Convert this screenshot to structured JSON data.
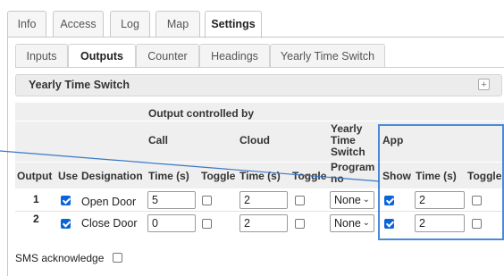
{
  "top_tabs": [
    {
      "label": "Info",
      "active": false
    },
    {
      "label": "Access",
      "active": false
    },
    {
      "label": "Log",
      "active": false
    },
    {
      "label": "Map",
      "active": false
    },
    {
      "label": "Settings",
      "active": true
    }
  ],
  "sub_tabs": [
    {
      "label": "Inputs",
      "active": false
    },
    {
      "label": "Outputs",
      "active": true
    },
    {
      "label": "Counter",
      "active": false
    },
    {
      "label": "Headings",
      "active": false
    },
    {
      "label": "Yearly Time Switch",
      "active": false
    }
  ],
  "section": {
    "title": "Yearly Time Switch",
    "expand_icon": "plus-icon"
  },
  "table": {
    "group_header": "Output controlled by",
    "call": "Call",
    "cloud": "Cloud",
    "yearly": "Yearly Time Switch",
    "app": "App",
    "columns": {
      "output": "Output",
      "use": "Use",
      "designation": "Designation",
      "call_time": "Time (s)",
      "call_toggle": "Toggle",
      "cloud_time": "Time (s)",
      "cloud_toggle": "Toggle",
      "program": "Program no",
      "app_show": "Show",
      "app_time": "Time (s)",
      "app_toggle": "Toggle"
    },
    "rows": [
      {
        "output": "1",
        "use": true,
        "designation": "Open Door",
        "call_time": "5",
        "call_toggle": false,
        "cloud_time": "2",
        "cloud_toggle": false,
        "program": "None",
        "app_show": true,
        "app_time": "2",
        "app_toggle": false
      },
      {
        "output": "2",
        "use": true,
        "designation": "Close Door",
        "call_time": "0",
        "call_toggle": false,
        "cloud_time": "2",
        "cloud_toggle": false,
        "program": "None",
        "app_show": true,
        "app_time": "2",
        "app_toggle": false
      }
    ]
  },
  "sms": {
    "label": "SMS acknowledge",
    "checked": false
  },
  "colors": {
    "accent": "#4a8ad8",
    "checkbox": "#0a66d8",
    "header_band": "#efefef"
  }
}
